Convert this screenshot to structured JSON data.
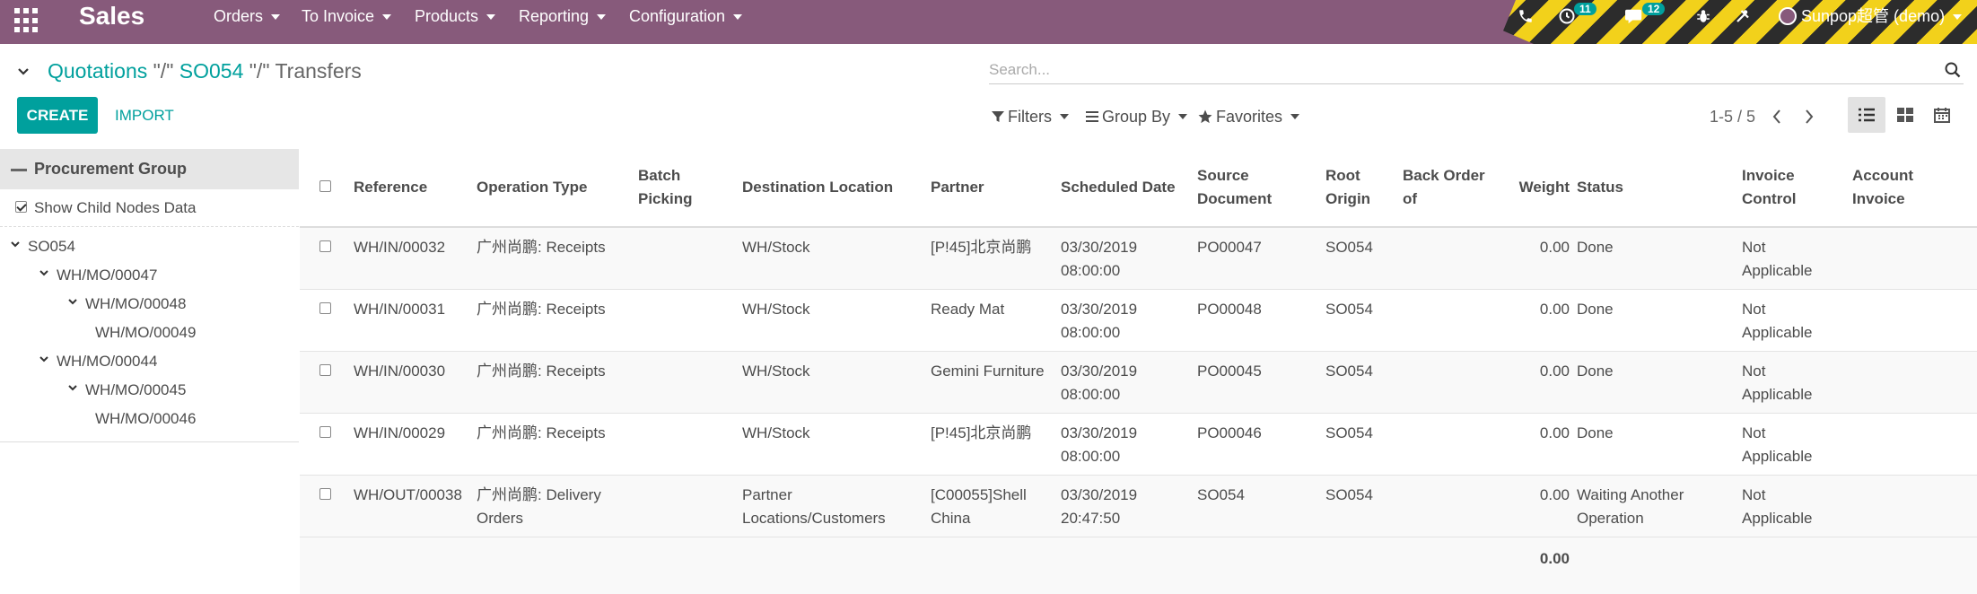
{
  "app": {
    "title": "Sales",
    "menu": [
      {
        "label": "Orders"
      },
      {
        "label": "To Invoice"
      },
      {
        "label": "Products"
      },
      {
        "label": "Reporting"
      },
      {
        "label": "Configuration"
      }
    ],
    "activity_badge": "11",
    "message_badge": "12",
    "user_label": "Sunpop超管 (demo)",
    "colors": {
      "navbar": "#875a7b",
      "accent": "#00a09d",
      "hazard_yellow": "#f2d11b"
    }
  },
  "breadcrumb": {
    "items": [
      "Quotations",
      "SO054",
      "Transfers"
    ],
    "separator": "\"/\""
  },
  "buttons": {
    "create": "CREATE",
    "import": "IMPORT"
  },
  "search": {
    "placeholder": "Search..."
  },
  "search_options": {
    "filters": "Filters",
    "group_by": "Group By",
    "favorites": "Favorites"
  },
  "pager": {
    "value": "1-5 / 5"
  },
  "left_panel": {
    "header": "Procurement Group",
    "show_child_label": "Show Child Nodes Data",
    "show_child_checked": true,
    "tree": [
      {
        "label": "SO054",
        "expanded": true
      },
      {
        "label": "WH/MO/00047",
        "expanded": true
      },
      {
        "label": "WH/MO/00048",
        "expanded": true
      },
      {
        "label": "WH/MO/00049",
        "expanded": false
      },
      {
        "label": "WH/MO/00044",
        "expanded": true
      },
      {
        "label": "WH/MO/00045",
        "expanded": true
      },
      {
        "label": "WH/MO/00046",
        "expanded": false
      }
    ]
  },
  "table": {
    "columns": [
      "Reference",
      "Operation Type",
      "Batch Picking",
      "Destination Location",
      "Partner",
      "Scheduled Date",
      "Source Document",
      "Root Origin",
      "Back Order of",
      "Weight",
      "Status",
      "Invoice Control",
      "Account Invoice"
    ],
    "rows": [
      {
        "reference": "WH/IN/00032",
        "operation_type": "广州尚鹏: Receipts",
        "batch_picking": "",
        "destination": "WH/Stock",
        "partner": "[P!45]北京尚鹏",
        "scheduled_date": "03/30/2019 08:00:00",
        "source_document": "PO00047",
        "root_origin": "SO054",
        "back_order": "",
        "weight": "0.00",
        "status": "Done",
        "invoice_control": "Not Applicable",
        "account_invoice": ""
      },
      {
        "reference": "WH/IN/00031",
        "operation_type": "广州尚鹏: Receipts",
        "batch_picking": "",
        "destination": "WH/Stock",
        "partner": "Ready Mat",
        "scheduled_date": "03/30/2019 08:00:00",
        "source_document": "PO00048",
        "root_origin": "SO054",
        "back_order": "",
        "weight": "0.00",
        "status": "Done",
        "invoice_control": "Not Applicable",
        "account_invoice": ""
      },
      {
        "reference": "WH/IN/00030",
        "operation_type": "广州尚鹏: Receipts",
        "batch_picking": "",
        "destination": "WH/Stock",
        "partner": "Gemini Furniture",
        "scheduled_date": "03/30/2019 08:00:00",
        "source_document": "PO00045",
        "root_origin": "SO054",
        "back_order": "",
        "weight": "0.00",
        "status": "Done",
        "invoice_control": "Not Applicable",
        "account_invoice": ""
      },
      {
        "reference": "WH/IN/00029",
        "operation_type": "广州尚鹏: Receipts",
        "batch_picking": "",
        "destination": "WH/Stock",
        "partner": "[P!45]北京尚鹏",
        "scheduled_date": "03/30/2019 08:00:00",
        "source_document": "PO00046",
        "root_origin": "SO054",
        "back_order": "",
        "weight": "0.00",
        "status": "Done",
        "invoice_control": "Not Applicable",
        "account_invoice": ""
      },
      {
        "reference": "WH/OUT/00038",
        "operation_type": "广州尚鹏: Delivery Orders",
        "batch_picking": "",
        "destination": "Partner Locations/Customers",
        "partner": "[C00055]Shell China",
        "scheduled_date": "03/30/2019 20:47:50",
        "source_document": "SO054",
        "root_origin": "SO054",
        "back_order": "",
        "weight": "0.00",
        "status": "Waiting Another Operation",
        "invoice_control": "Not Applicable",
        "account_invoice": ""
      }
    ],
    "total_weight": "0.00"
  }
}
